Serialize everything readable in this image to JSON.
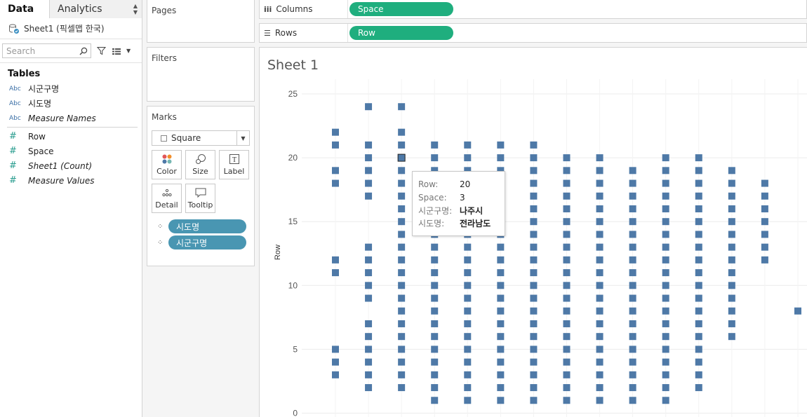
{
  "left_pane": {
    "tab_data": "Data",
    "tab_analytics": "Analytics",
    "datasource": "Sheet1 (픽셀맵 한국)",
    "search_placeholder": "Search",
    "tables_title": "Tables",
    "fields": [
      {
        "type": "Abc",
        "label": "시군구명",
        "italic": false
      },
      {
        "type": "Abc",
        "label": "시도명",
        "italic": false
      },
      {
        "type": "Abc",
        "label": "Measure Names",
        "italic": true
      },
      {
        "type": "#",
        "label": "Row",
        "italic": false
      },
      {
        "type": "#",
        "label": "Space",
        "italic": false
      },
      {
        "type": "#",
        "label": "Sheet1 (Count)",
        "italic": true
      },
      {
        "type": "#",
        "label": "Measure Values",
        "italic": true
      }
    ]
  },
  "shelves": {
    "pages": "Pages",
    "filters": "Filters",
    "marks": "Marks",
    "mark_type": "Square",
    "buttons": {
      "color": "Color",
      "size": "Size",
      "label": "Label",
      "detail": "Detail",
      "tooltip": "Tooltip"
    },
    "detail_pills": [
      "시도명",
      "시군구명"
    ],
    "columns_label": "Columns",
    "columns_pill": "Space",
    "rows_label": "Rows",
    "rows_pill": "Row"
  },
  "sheet_title": "Sheet 1",
  "tooltip": {
    "row_key": "Row:",
    "row_val": "20",
    "space_key": "Space:",
    "space_val": "3",
    "sigungu_key": "시군구명:",
    "sigungu_val": "나주시",
    "sido_key": "시도명:",
    "sido_val": "전라남도"
  },
  "colors": {
    "mark": "#4e79a7",
    "green_pill": "#1fae7e",
    "blue_pill": "#4996b2"
  },
  "chart_data": {
    "type": "scatter",
    "mark": "square",
    "ylabel": "Row",
    "ylim": [
      0,
      25
    ],
    "yticks": [
      0,
      5,
      10,
      15,
      20,
      25
    ],
    "columns": [
      {
        "space": 1,
        "rows": [
          3,
          4,
          5,
          11,
          12,
          18,
          19,
          21,
          22
        ]
      },
      {
        "space": 2,
        "rows": [
          2,
          3,
          4,
          5,
          6,
          7,
          9,
          10,
          11,
          12,
          13,
          17,
          18,
          19,
          20,
          21,
          24
        ]
      },
      {
        "space": 3,
        "rows": [
          2,
          3,
          4,
          5,
          6,
          7,
          8,
          9,
          10,
          11,
          12,
          13,
          14,
          15,
          16,
          17,
          18,
          19,
          20,
          21,
          22,
          24
        ]
      },
      {
        "space": 4,
        "rows": [
          1,
          2,
          3,
          4,
          5,
          6,
          7,
          8,
          9,
          10,
          11,
          12,
          13,
          14,
          15,
          16,
          17,
          18,
          19,
          20,
          21
        ]
      },
      {
        "space": 5,
        "rows": [
          1,
          2,
          3,
          4,
          5,
          6,
          7,
          8,
          9,
          10,
          11,
          12,
          13,
          14,
          15,
          16,
          17,
          18,
          19,
          20,
          21
        ]
      },
      {
        "space": 6,
        "rows": [
          1,
          2,
          3,
          4,
          5,
          6,
          7,
          8,
          9,
          10,
          11,
          12,
          13,
          14,
          15,
          16,
          17,
          18,
          19,
          20,
          21
        ]
      },
      {
        "space": 7,
        "rows": [
          1,
          2,
          3,
          4,
          5,
          6,
          7,
          8,
          9,
          10,
          11,
          12,
          13,
          14,
          15,
          16,
          17,
          18,
          19,
          20,
          21
        ]
      },
      {
        "space": 8,
        "rows": [
          1,
          2,
          3,
          4,
          5,
          6,
          7,
          8,
          9,
          10,
          11,
          12,
          13,
          14,
          15,
          16,
          17,
          18,
          19,
          20
        ]
      },
      {
        "space": 9,
        "rows": [
          1,
          2,
          3,
          4,
          5,
          6,
          7,
          8,
          9,
          10,
          11,
          12,
          13,
          14,
          15,
          16,
          17,
          18,
          19,
          20
        ]
      },
      {
        "space": 10,
        "rows": [
          1,
          2,
          3,
          4,
          5,
          6,
          7,
          8,
          9,
          10,
          11,
          12,
          13,
          14,
          15,
          16,
          17,
          18,
          19
        ]
      },
      {
        "space": 11,
        "rows": [
          1,
          2,
          3,
          4,
          5,
          6,
          7,
          8,
          9,
          10,
          11,
          12,
          13,
          14,
          15,
          16,
          17,
          18,
          19,
          20
        ]
      },
      {
        "space": 12,
        "rows": [
          2,
          3,
          4,
          5,
          6,
          7,
          8,
          9,
          10,
          11,
          12,
          13,
          14,
          15,
          16,
          17,
          18,
          19,
          20
        ]
      },
      {
        "space": 13,
        "rows": [
          6,
          7,
          8,
          9,
          10,
          11,
          12,
          13,
          14,
          15,
          16,
          17,
          18,
          19
        ]
      },
      {
        "space": 14,
        "rows": [
          12,
          13,
          14,
          15,
          16,
          17,
          18
        ]
      },
      {
        "space": 15,
        "rows": [
          8
        ]
      }
    ],
    "highlighted": {
      "space": 3,
      "row": 20
    }
  }
}
